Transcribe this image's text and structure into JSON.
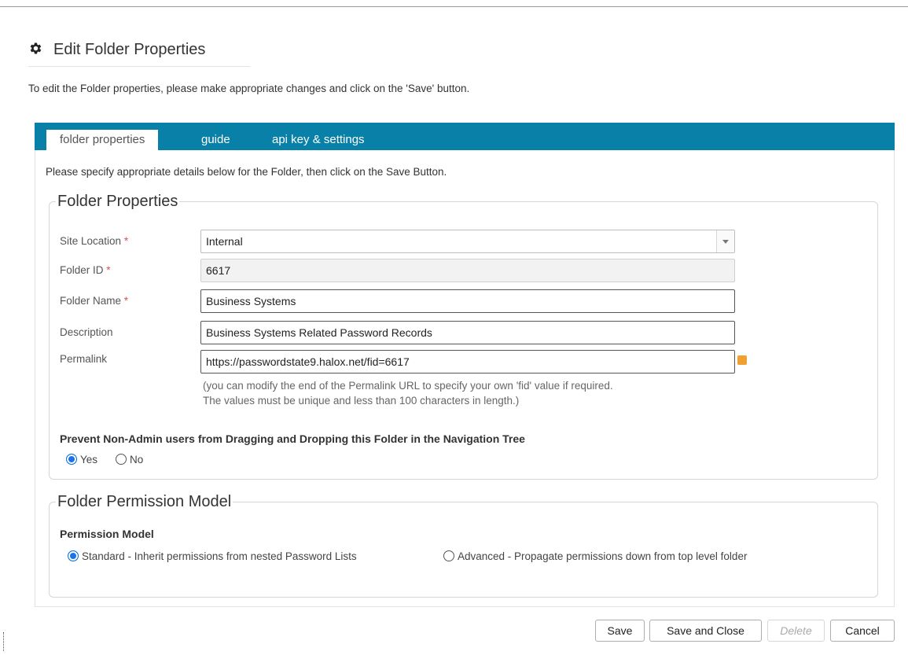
{
  "header": {
    "title": "Edit Folder Properties",
    "intro": "To edit the Folder properties, please make appropriate changes and click on the 'Save' button.",
    "icon": "gear-icon"
  },
  "tabs": [
    {
      "label": "folder properties",
      "active": true
    },
    {
      "label": "guide",
      "active": false
    },
    {
      "label": "api key & settings",
      "active": false
    }
  ],
  "panel_note": "Please specify appropriate details below for the Folder, then click on the Save Button.",
  "folder_properties": {
    "legend": "Folder Properties",
    "site_location": {
      "label": "Site Location",
      "required_mark": "*",
      "value": "Internal"
    },
    "folder_id": {
      "label": "Folder ID",
      "required_mark": "*",
      "value": "6617"
    },
    "folder_name": {
      "label": "Folder Name",
      "required_mark": "*",
      "value": "Business Systems"
    },
    "description": {
      "label": "Description",
      "value": "Business Systems Related Password Records"
    },
    "permalink": {
      "label": "Permalink",
      "value": "https://passwordstate9.halox.net/fid=6617",
      "help_line1": "(you can modify the end of the Permalink URL to specify your own 'fid' value if required.",
      "help_line2": "The values must be unique and less than 100 characters in length.)"
    },
    "prevent_drag": {
      "label": "Prevent Non-Admin users from Dragging and Dropping this Folder in the Navigation Tree",
      "options": [
        "Yes",
        "No"
      ],
      "selected": "Yes"
    }
  },
  "permission_model": {
    "legend": "Folder Permission Model",
    "label": "Permission Model",
    "options": [
      "Standard - Inherit permissions from nested Password Lists",
      "Advanced - Propagate permissions down from top level folder"
    ],
    "selected": "Standard - Inherit permissions from nested Password Lists"
  },
  "buttons": {
    "save": "Save",
    "save_close": "Save and Close",
    "delete": "Delete",
    "cancel": "Cancel"
  },
  "colors": {
    "tabbar": "#0880a8",
    "required": "#d9534f",
    "radio_selected": "#1a73e8"
  }
}
